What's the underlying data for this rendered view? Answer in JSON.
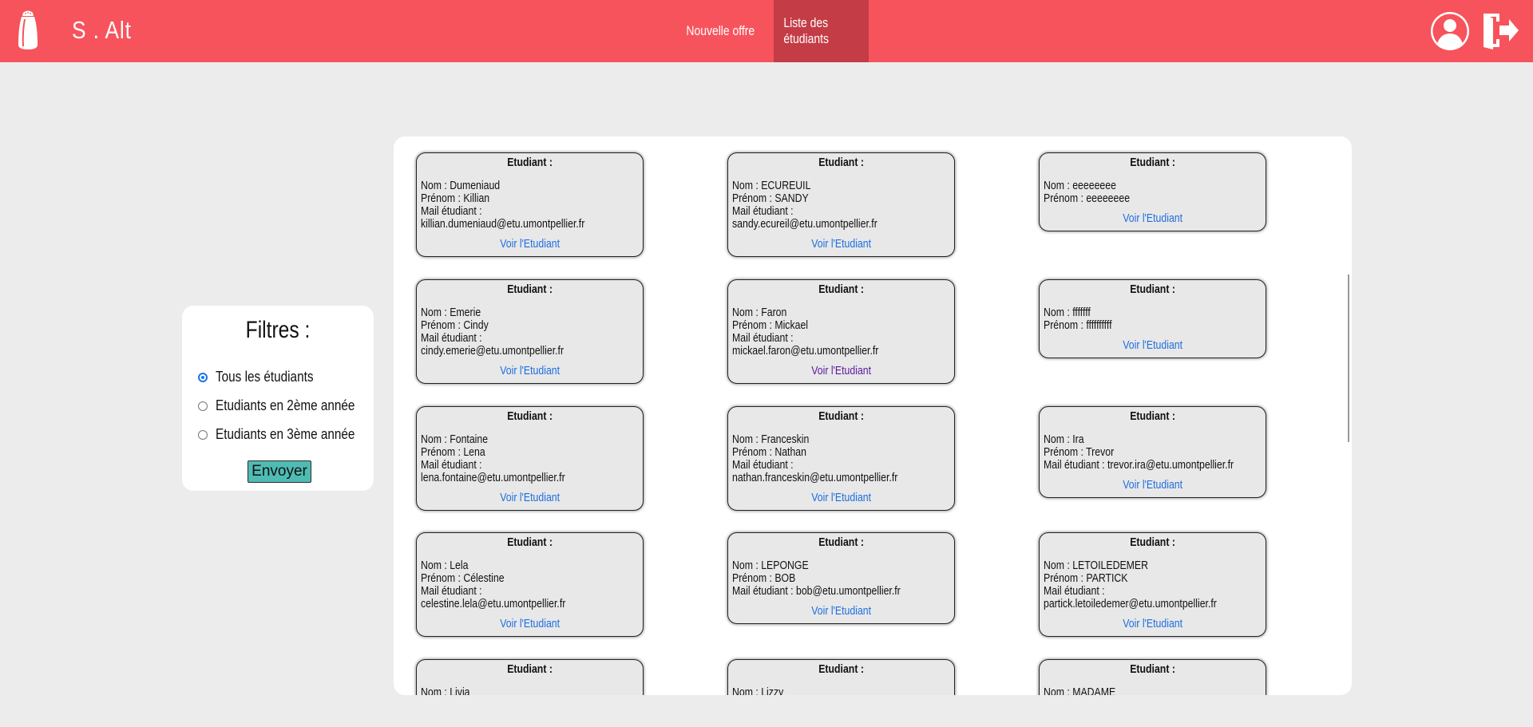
{
  "header": {
    "brand": "S . Alt",
    "nav": [
      {
        "label": "Nouvelle offre"
      },
      {
        "label": "Liste des étudiants"
      }
    ]
  },
  "filters": {
    "title": "Filtres :",
    "options": [
      {
        "label": "Tous les étudiants",
        "checked": true
      },
      {
        "label": "Etudiants en 2ème année",
        "checked": false
      },
      {
        "label": "Etudiants en 3ème année",
        "checked": false
      }
    ],
    "submit_label": "Envoyer"
  },
  "cards": {
    "title_label": "Etudiant :",
    "link_label": "Voir l'Etudiant",
    "items": [
      {
        "nom": "Nom : Dumeniaud",
        "prenom": "Prénom : Killian",
        "mail_label": "Mail étudiant :",
        "mail": "killian.dumeniaud@etu.umontpellier.fr"
      },
      {
        "nom": "Nom : ECUREUIL",
        "prenom": "Prénom : SANDY",
        "mail_label": "Mail étudiant :",
        "mail": "sandy.ecureil@etu.umontpellier.fr"
      },
      {
        "nom": "Nom : eeeeeeee",
        "prenom": "Prénom : eeeeeeee"
      },
      {
        "nom": "Nom : Emerie",
        "prenom": "Prénom : Cindy",
        "mail_label": "Mail étudiant :",
        "mail": "cindy.emerie@etu.umontpellier.fr"
      },
      {
        "nom": "Nom : Faron",
        "prenom": "Prénom : Mickael",
        "mail_label": "Mail étudiant :",
        "mail": "mickael.faron@etu.umontpellier.fr"
      },
      {
        "nom": "Nom : fffffff",
        "prenom": "Prénom : ffffffffff"
      },
      {
        "nom": "Nom : Fontaine",
        "prenom": "Prénom : Lena",
        "mail_label": "Mail étudiant :",
        "mail": "lena.fontaine@etu.umontpellier.fr"
      },
      {
        "nom": "Nom : Franceskin",
        "prenom": "Prénom : Nathan",
        "mail_label": "Mail étudiant :",
        "mail": "nathan.franceskin@etu.umontpellier.fr"
      },
      {
        "nom": "Nom : Ira",
        "prenom": "Prénom : Trevor",
        "mail_inline": "Mail étudiant : trevor.ira@etu.umontpellier.fr"
      },
      {
        "nom": "Nom : Lela",
        "prenom": "Prénom : Célestine",
        "mail_label": "Mail étudiant :",
        "mail": "celestine.lela@etu.umontpellier.fr"
      },
      {
        "nom": "Nom : LEPONGE",
        "prenom": "Prénom : BOB",
        "mail_inline": "Mail étudiant : bob@etu.umontpellier.fr"
      },
      {
        "nom": "Nom : LETOILEDEMER",
        "prenom": "Prénom : PARTICK",
        "mail_label": "Mail étudiant :",
        "mail": "partick.letoiledemer@etu.umontpellier.fr"
      },
      {
        "nom": "Nom : Livia"
      },
      {
        "nom": "Nom : Lizzy"
      },
      {
        "nom": "Nom : MADAME"
      }
    ]
  },
  "colors": {
    "header": "#f7535c",
    "nav_active": "#c43c45",
    "link": "#1d6ee0",
    "link_visited": "#5b1a9e",
    "button": "#4fbcb4"
  }
}
